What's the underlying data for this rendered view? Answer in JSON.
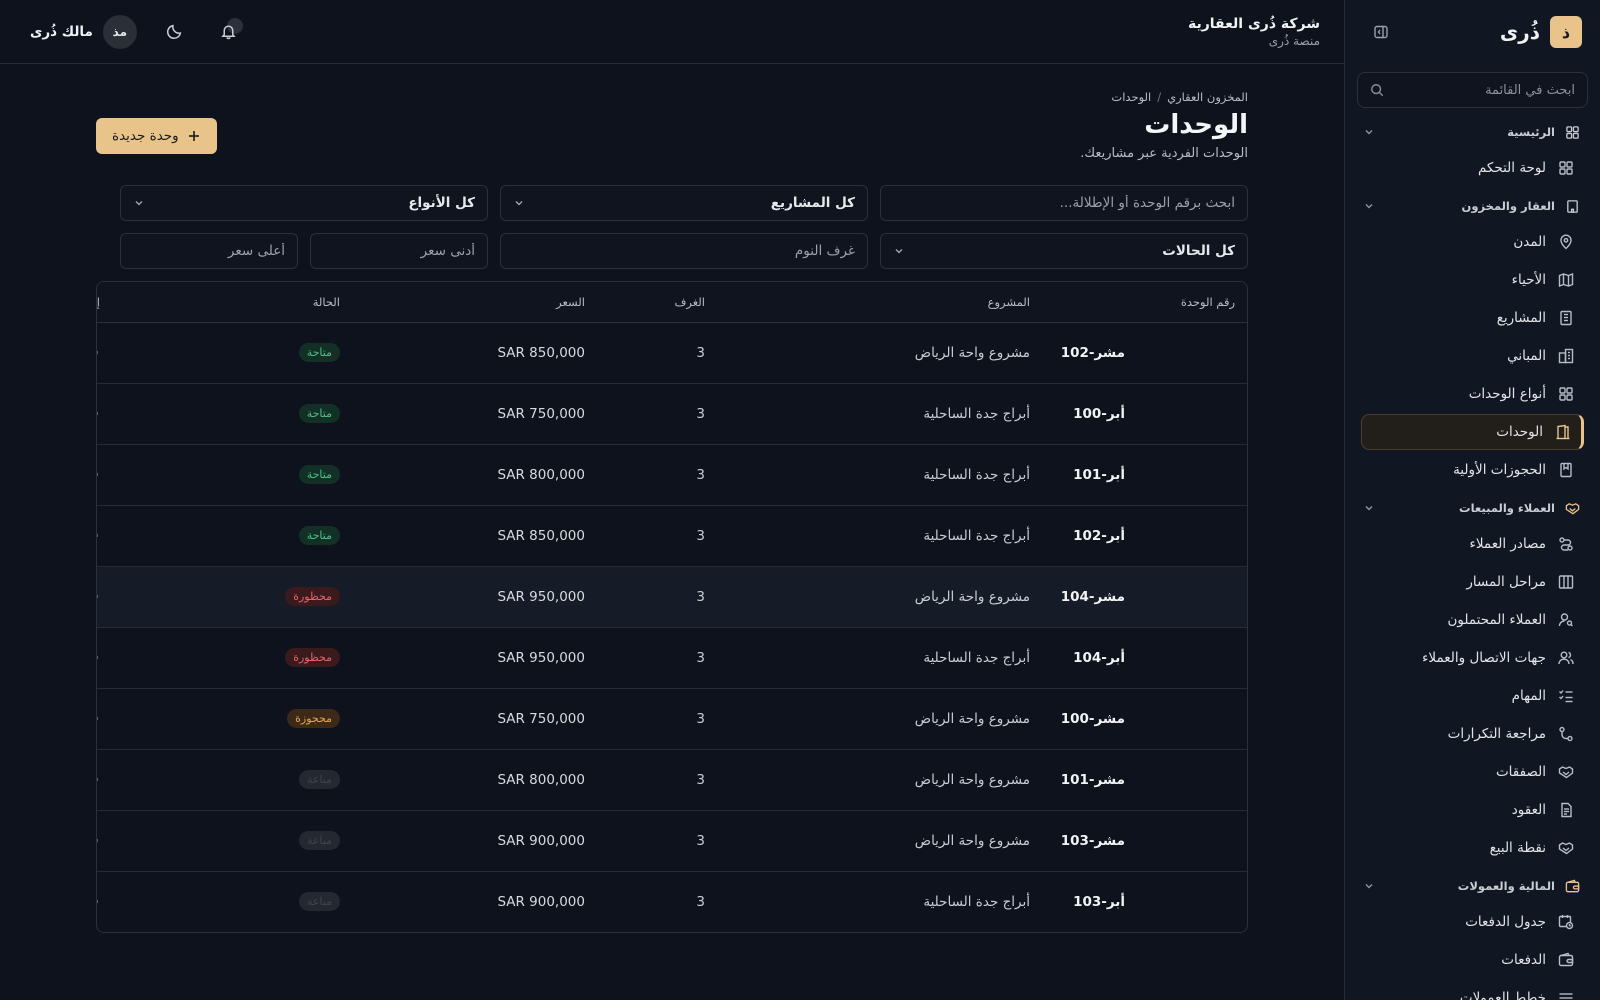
{
  "brand": {
    "logo_letter": "ذ",
    "name": "ذُرى",
    "accent": "#e8c48a"
  },
  "sidebar": {
    "search_placeholder": "ابحث في القائمة",
    "groups": [
      {
        "label": "الرئيسية",
        "items": [
          "لوحة التحكم"
        ]
      },
      {
        "label": "العقار والمخزون",
        "items": [
          "المدن",
          "الأحياء",
          "المشاريع",
          "المباني",
          "أنواع الوحدات",
          "الوحدات",
          "الحجوزات الأولية"
        ]
      },
      {
        "label": "العملاء والمبيعات",
        "items": [
          "مصادر العملاء",
          "مراحل المسار",
          "العملاء المحتملون",
          "جهات الاتصال والعملاء",
          "المهام",
          "مراجعة التكرارات",
          "الصفقات",
          "العقود",
          "نقطة البيع"
        ]
      },
      {
        "label": "المالية والعمولات",
        "items": [
          "جدول الدفعات",
          "الدفعات",
          "خطط العمولات"
        ]
      }
    ]
  },
  "header": {
    "org_name": "شركة ذُرى العقارية",
    "org_sub": "منصة ذُرى",
    "user_initials": "مذ",
    "user_name": "مالك ذُرى"
  },
  "page": {
    "breadcrumb": [
      "المخزون العقاري",
      "/",
      "الوحدات"
    ],
    "title": "الوحدات",
    "subtitle": "الوحدات الفردية عبر مشاريعك.",
    "new_button": "وحدة جديدة"
  },
  "filters": {
    "search_placeholder": "ابحث برقم الوحدة أو الإطلالة...",
    "project_select": "كل المشاريع",
    "type_select": "كل الأنواع",
    "status_select": "كل الحالات",
    "bedrooms_placeholder": "غرف النوم",
    "min_price_placeholder": "أدنى سعر",
    "max_price_placeholder": "أعلى سعر"
  },
  "table": {
    "columns": [
      "رقم الوحدة",
      "المشروع",
      "الغرف",
      "السعر",
      "الحالة",
      "إجراءات"
    ],
    "rows": [
      {
        "unit": "مشر-102",
        "project": "مشروع واحة الرياض",
        "rooms": "3",
        "price": "SAR 850,000",
        "status": "متاحة",
        "status_kind": "green"
      },
      {
        "unit": "أبر-100",
        "project": "أبراج جدة الساحلية",
        "rooms": "3",
        "price": "SAR 750,000",
        "status": "متاحة",
        "status_kind": "green"
      },
      {
        "unit": "أبر-101",
        "project": "أبراج جدة الساحلية",
        "rooms": "3",
        "price": "SAR 800,000",
        "status": "متاحة",
        "status_kind": "green"
      },
      {
        "unit": "أبر-102",
        "project": "أبراج جدة الساحلية",
        "rooms": "3",
        "price": "SAR 850,000",
        "status": "متاحة",
        "status_kind": "green"
      },
      {
        "unit": "مشر-104",
        "project": "مشروع واحة الرياض",
        "rooms": "3",
        "price": "SAR 950,000",
        "status": "محظورة",
        "status_kind": "red"
      },
      {
        "unit": "أبر-104",
        "project": "أبراج جدة الساحلية",
        "rooms": "3",
        "price": "SAR 950,000",
        "status": "محظورة",
        "status_kind": "red"
      },
      {
        "unit": "مشر-100",
        "project": "مشروع واحة الرياض",
        "rooms": "3",
        "price": "SAR 750,000",
        "status": "محجوزة",
        "status_kind": "orange"
      },
      {
        "unit": "مشر-101",
        "project": "مشروع واحة الرياض",
        "rooms": "3",
        "price": "SAR 800,000",
        "status": "مباعة",
        "status_kind": "faint"
      },
      {
        "unit": "مشر-103",
        "project": "مشروع واحة الرياض",
        "rooms": "3",
        "price": "SAR 900,000",
        "status": "مباعة",
        "status_kind": "faint"
      },
      {
        "unit": "أبر-103",
        "project": "أبراج جدة الساحلية",
        "rooms": "3",
        "price": "SAR 900,000",
        "status": "مباعة",
        "status_kind": "faint"
      }
    ],
    "actions_glyph": "···"
  }
}
